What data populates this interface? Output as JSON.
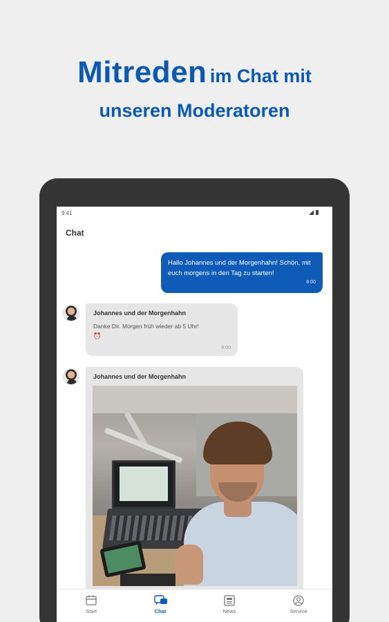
{
  "headline": {
    "emphasis": "Mitreden",
    "rest_line1": "im Chat mit",
    "line2": "unseren Moderatoren"
  },
  "status_bar": {
    "time": "9:41"
  },
  "app": {
    "title": "Chat"
  },
  "messages": [
    {
      "direction": "outgoing",
      "text": "Hallo Johannes und der Morgenhahn! Schön, mit euch morgens in den Tag zu starten!",
      "time": "8:00"
    },
    {
      "direction": "incoming",
      "sender": "Johannes und der Morgenhahn",
      "text": "Danke Dir. Morgen früh wieder ab 5 Uhr!",
      "emoji": "⏰",
      "time": "8:00"
    },
    {
      "direction": "incoming",
      "sender": "Johannes und der Morgenhahn",
      "type": "image"
    }
  ],
  "tab_bar": {
    "items": [
      {
        "label": "Start",
        "icon": "calendar-icon",
        "active": false
      },
      {
        "label": "Chat",
        "icon": "chat-icon",
        "active": true
      },
      {
        "label": "News",
        "icon": "news-icon",
        "active": false
      },
      {
        "label": "Service",
        "icon": "user-icon",
        "active": false
      }
    ]
  },
  "colors": {
    "brand_blue": "#0f5cb8",
    "headline_blue": "#0a59b4",
    "bubble_gray": "#e6e6e6",
    "device_frame": "#353535"
  }
}
